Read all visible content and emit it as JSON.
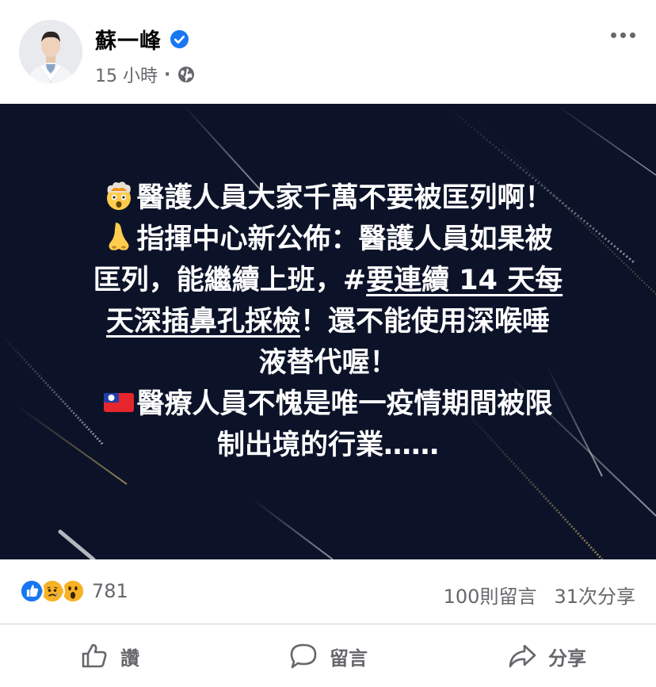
{
  "post": {
    "author": "蘇一峰",
    "time": "15 小時",
    "separator": "·",
    "privacy_icon": "globe-icon",
    "verified_icon": "verified-badge-icon"
  },
  "image_text": {
    "line1": "醫護人員大家千萬不要被匡列啊！",
    "line2": "指揮中心新公佈：醫護人員如果被",
    "line3a": "匡列，能繼續上班，#",
    "line3b": "要連續 14 天每",
    "line4a": "天深插鼻孔採檢",
    "line4b": "！還不能使用深喉唾",
    "line5": "液替代喔！",
    "line6": "醫療人員不愧是唯一疫情期間被限",
    "line7": "制出境的行業……"
  },
  "stats": {
    "reaction_count": "781",
    "comments": "100則留言",
    "shares": "31次分享"
  },
  "actions": {
    "like": "讚",
    "comment": "留言",
    "share": "分享"
  },
  "colors": {
    "brand_blue": "#1877f2",
    "image_bg": "#0c1329",
    "secondary_text": "#65676b"
  }
}
